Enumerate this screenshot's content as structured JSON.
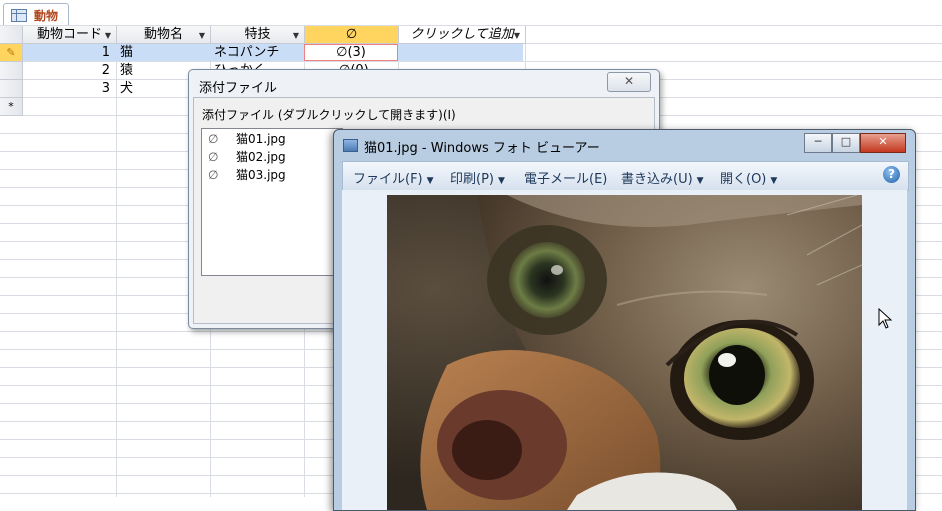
{
  "table_tab": {
    "label": "動物"
  },
  "columns": [
    {
      "label": "動物コード"
    },
    {
      "label": "動物名"
    },
    {
      "label": "特技"
    },
    {
      "label": "∅"
    },
    {
      "label": "クリックして追加"
    }
  ],
  "rows": [
    {
      "code": "1",
      "name": "猫",
      "skill": "ネコパンチ",
      "attach": "(3)"
    },
    {
      "code": "2",
      "name": "猿",
      "skill": "ひっかく",
      "attach": "(0)"
    },
    {
      "code": "3",
      "name": "犬",
      "skill": "",
      "attach": ""
    }
  ],
  "new_row_marker": "*",
  "attachment_dialog": {
    "title": "添付ファイル",
    "close_label": "✕",
    "list_label": "添付ファイル (ダブルクリックして開きます)(I)",
    "files": [
      "猫01.jpg",
      "猫02.jpg",
      "猫03.jpg"
    ]
  },
  "photo_viewer": {
    "title": "猫01.jpg - Windows フォト ビューアー",
    "minimize_label": "─",
    "maximize_label": "□",
    "close_label": "✕",
    "menu": [
      {
        "label": "ファイル(F)",
        "arrow": "▼"
      },
      {
        "label": "印刷(P)",
        "arrow": "▼"
      },
      {
        "label": "電子メール(E)",
        "arrow": ""
      },
      {
        "label": "書き込み(U)",
        "arrow": "▼"
      },
      {
        "label": "開く(O)",
        "arrow": "▼"
      }
    ],
    "help_label": "?"
  },
  "colors": {
    "selected_header": "#ffd45f",
    "current_row": "#c9ddf7",
    "tab_text": "#b0471e"
  }
}
